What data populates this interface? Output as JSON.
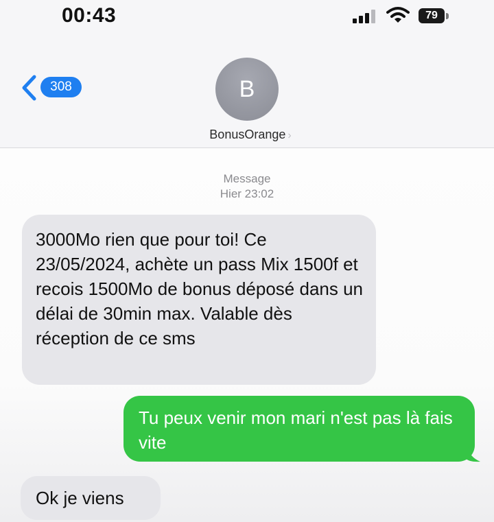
{
  "status_bar": {
    "time": "00:43",
    "battery": "79",
    "icons": [
      "signal-icon",
      "wifi-icon",
      "battery-icon"
    ]
  },
  "header": {
    "back_badge": "308",
    "avatar_initial": "B",
    "contact_name": "BonusOrange",
    "contact_chevron": "›"
  },
  "conversation": {
    "service_label": "Message",
    "timestamp": "Hier 23:02",
    "messages": [
      {
        "direction": "incoming",
        "text": "3000Mo rien que pour toi! Ce 23/05/2024, achète un pass Mix 1500f et recois 1500Mo de bonus déposé dans un délai de 30min max. Valable dès réception de ce sms"
      },
      {
        "direction": "outgoing",
        "text": "Tu peux venir mon mari n'est pas là fais vite"
      },
      {
        "direction": "incoming",
        "text": "Ok je viens"
      }
    ]
  },
  "colors": {
    "accent_blue": "#1f7ff0",
    "outgoing_bubble": "#35c546",
    "incoming_bubble": "#e6e6ea",
    "avatar_gray": "#9a9ca5"
  }
}
